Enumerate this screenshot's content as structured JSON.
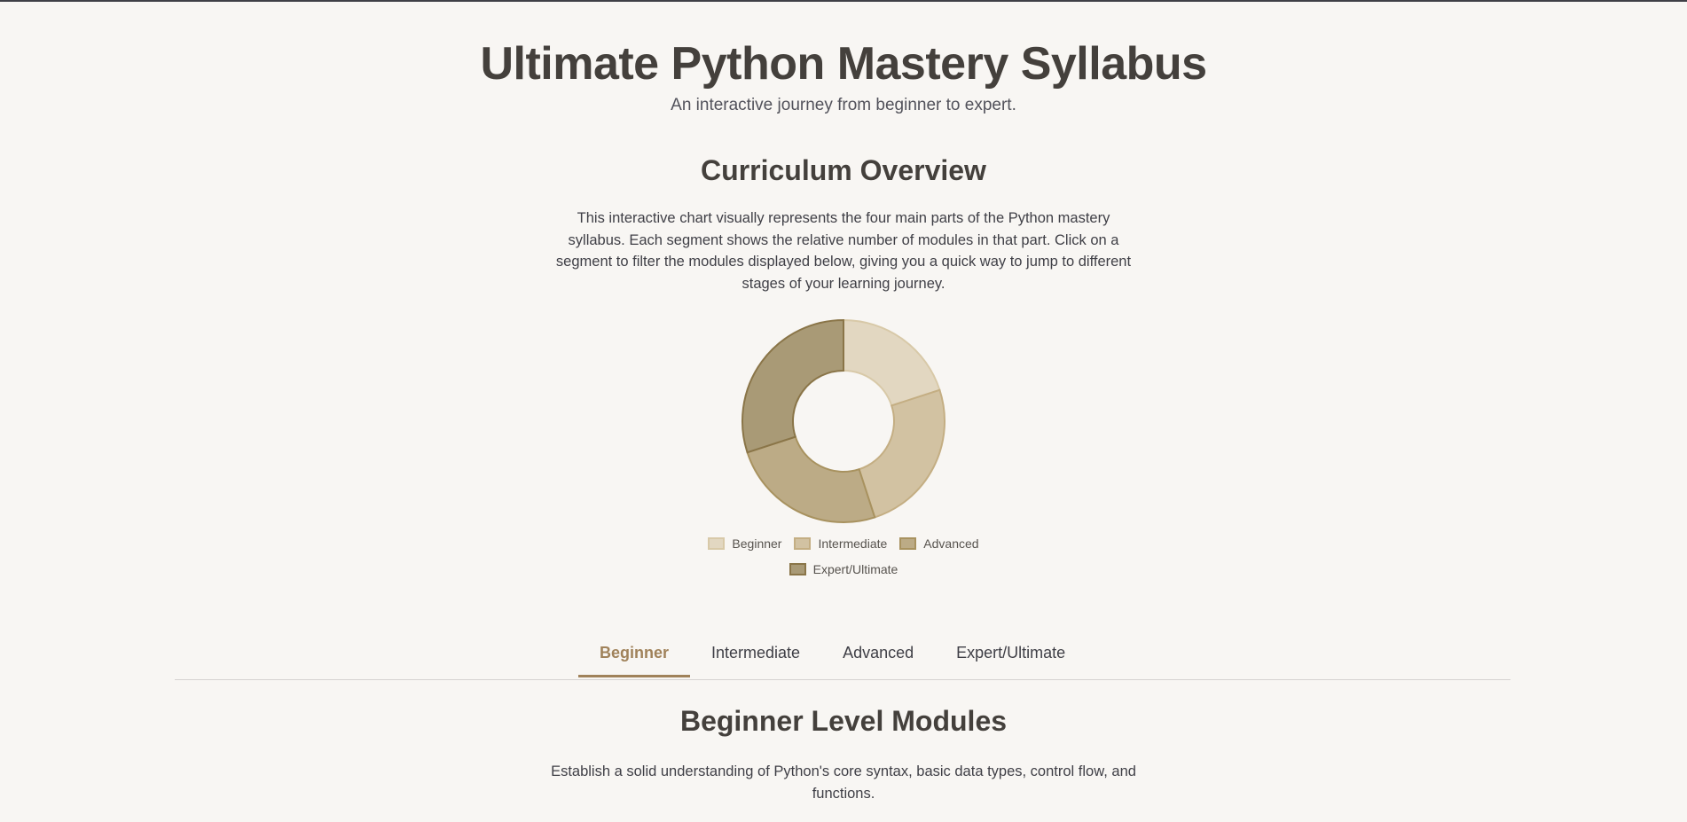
{
  "header": {
    "title": "Ultimate Python Mastery Syllabus",
    "subtitle": "An interactive journey from beginner to expert."
  },
  "overview": {
    "title": "Curriculum Overview",
    "description": "This interactive chart visually represents the four main parts of the Python mastery syllabus. Each segment shows the relative number of modules in that part. Click on a segment to filter the modules displayed below, giving you a quick way to jump to different stages of your learning journey."
  },
  "chart_data": {
    "type": "pie",
    "subtype": "doughnut",
    "categories": [
      "Beginner",
      "Intermediate",
      "Advanced",
      "Expert/Ultimate"
    ],
    "values": [
      20,
      25,
      25,
      30
    ],
    "colors": [
      "#e2d7c1",
      "#d2c2a2",
      "#bcab86",
      "#a99a76"
    ],
    "borders": [
      "#d8c9a8",
      "#c4ae83",
      "#a8925f",
      "#8a7548"
    ],
    "legend_position": "bottom",
    "start_angle_deg": -90
  },
  "tabs": [
    {
      "label": "Beginner",
      "active": true
    },
    {
      "label": "Intermediate",
      "active": false
    },
    {
      "label": "Advanced",
      "active": false
    },
    {
      "label": "Expert/Ultimate",
      "active": false
    }
  ],
  "level": {
    "title": "Beginner Level Modules",
    "description": "Establish a solid understanding of Python's core syntax, basic data types, control flow, and functions."
  },
  "colors": {
    "background": "#f8f6f3",
    "accent": "#a0825a",
    "text": "#3f3f46"
  }
}
